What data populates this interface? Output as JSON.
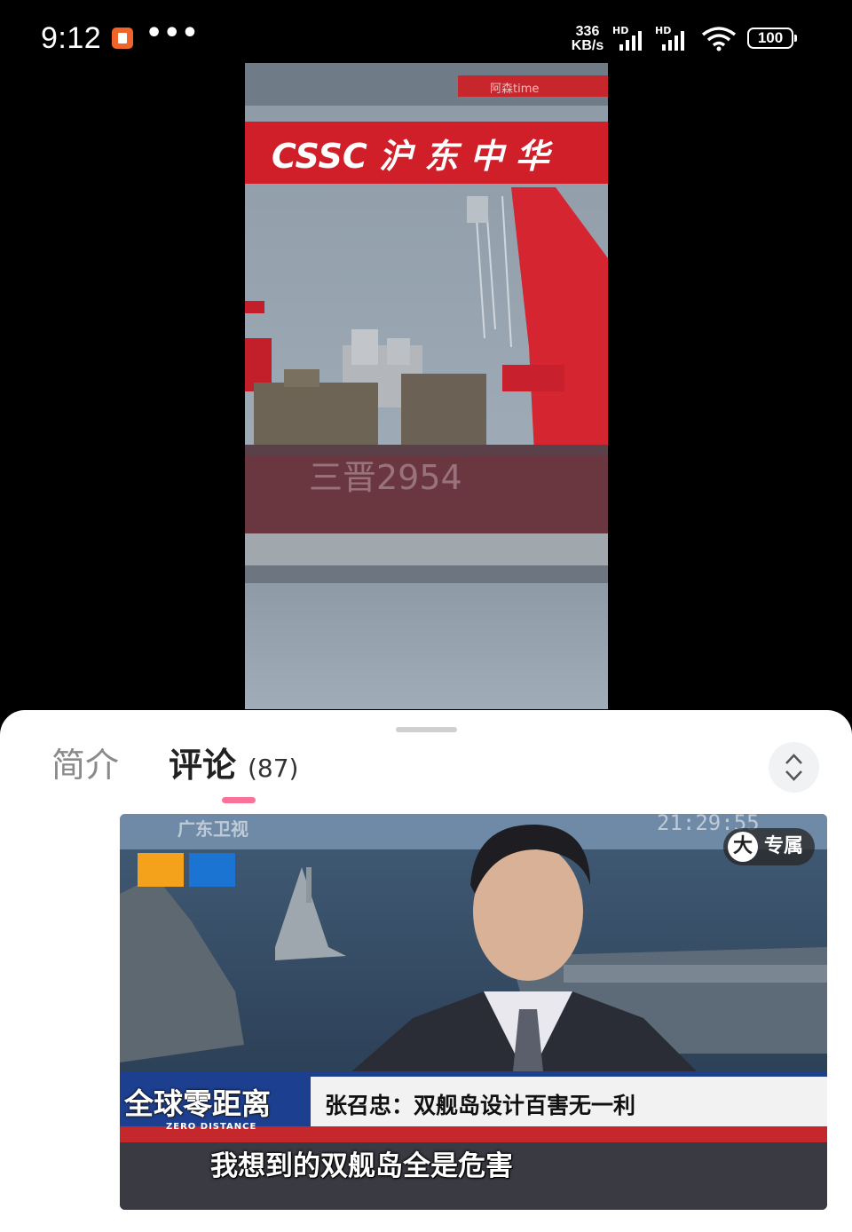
{
  "status_bar": {
    "time": "9:12",
    "more": "•••",
    "net_speed_value": "336",
    "net_speed_unit": "KB/s",
    "signal_1_label": "HD",
    "signal_2_label": "HD",
    "battery": "100"
  },
  "video": {
    "watermark": "阿森time",
    "gantry_text": "CSSC 沪 东 中 华",
    "hull_text": "三晋2954"
  },
  "sheet": {
    "tabs": [
      {
        "label": "简介"
      },
      {
        "label": "评论"
      }
    ],
    "comment_count": "(87)"
  },
  "comment_image": {
    "channel_logo": "广东卫视",
    "timecode": "21:29:55",
    "badge_label": "专属",
    "badge_icon_char": "大",
    "show_name": "全球零距离",
    "show_name_en": "ZERO DISTANCE",
    "headline": "张召忠：双舰岛设计百害无一利",
    "subtitle": "我想到的双舰岛全是危害"
  }
}
